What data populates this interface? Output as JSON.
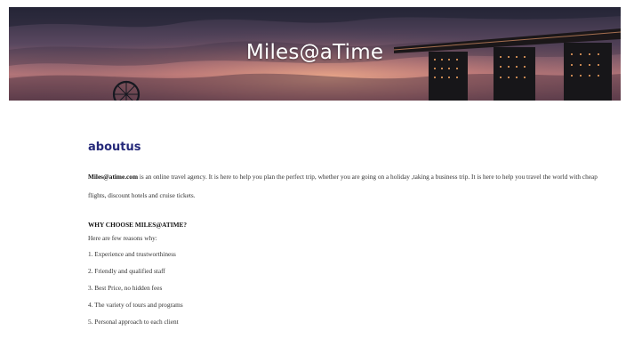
{
  "hero": {
    "title": "Miles@aTime"
  },
  "about": {
    "heading": "aboutus",
    "brand_strong": "Miles@atime.com",
    "intro_text": " is an online travel agency. It is here to help you plan the perfect trip, whether you are going on a holiday ,taking a business trip. It is here to help you travel the world with cheap flights, discount hotels and cruise tickets."
  },
  "why": {
    "heading": "WHY CHOOSE MILES@ATIME?",
    "subheading": "Here are few reasons why:",
    "reasons": [
      "1. Experience and trustworthiness",
      "2. Friendly and qualified staff",
      "3. Best Price, no hidden fees",
      "4. The variety of tours and programs",
      "5. Personal approach to each client"
    ]
  },
  "colors": {
    "heading": "#25297a",
    "text": "#333333",
    "hero_sky_top": "#2b2a3b",
    "hero_sky_glow": "#c98673"
  }
}
